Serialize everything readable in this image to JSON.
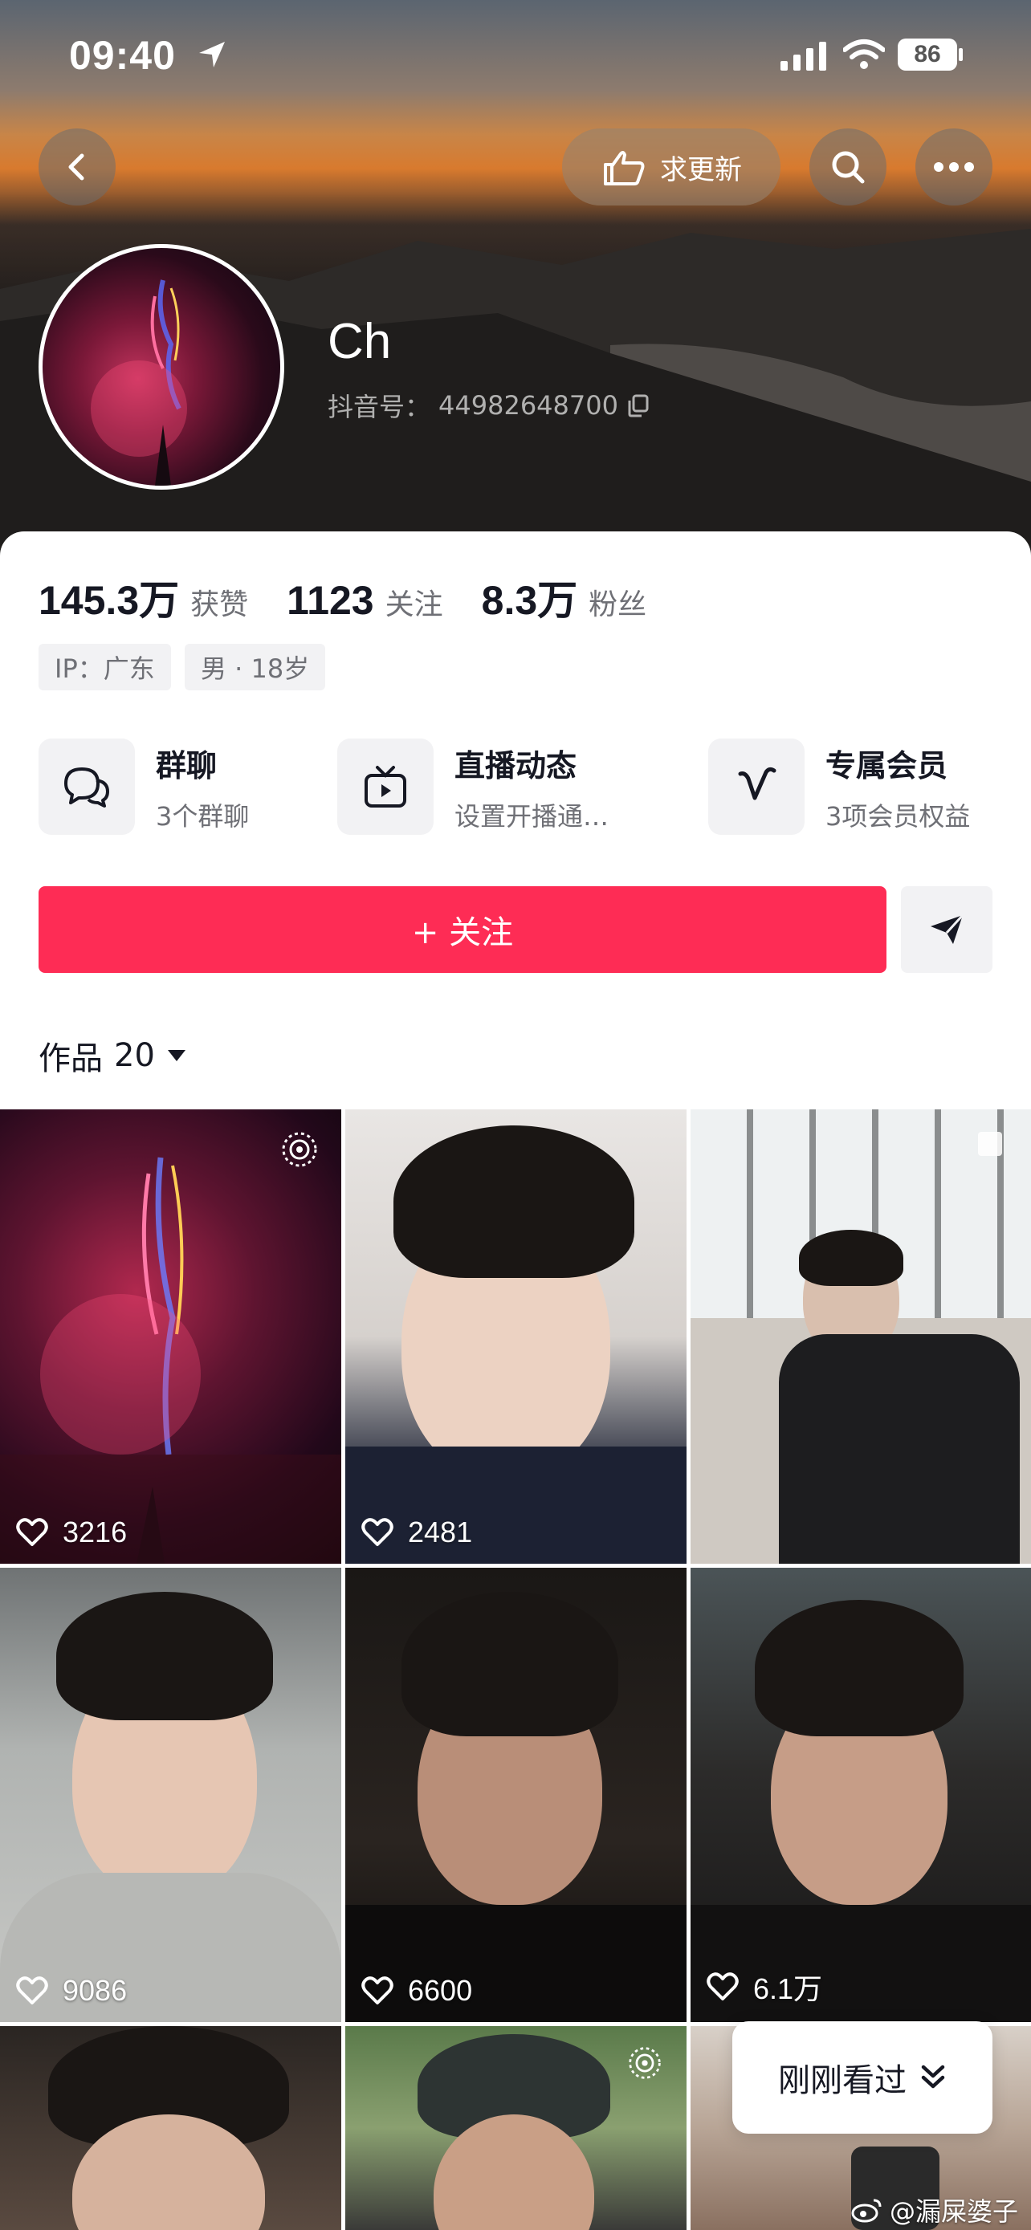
{
  "status_bar": {
    "time": "09:40",
    "battery": "86"
  },
  "header": {
    "request_update_label": "求更新"
  },
  "profile": {
    "name": "Ch",
    "douyin_id_label": "抖音号：",
    "douyin_id": "44982648700"
  },
  "stats": [
    {
      "value": "145.3万",
      "label": "获赞"
    },
    {
      "value": "1123",
      "label": "关注"
    },
    {
      "value": "8.3万",
      "label": "粉丝"
    }
  ],
  "tags": [
    "IP：广东",
    "男 · 18岁"
  ],
  "features": [
    {
      "title": "群聊",
      "subtitle": "3个群聊",
      "icon": "chat-bubbles-icon"
    },
    {
      "title": "直播动态",
      "subtitle": "设置开播通…",
      "icon": "tv-icon"
    },
    {
      "title": "专属会员",
      "subtitle": "3项会员权益",
      "icon": "v-badge-icon"
    }
  ],
  "follow_label": "+ 关注",
  "works": {
    "label": "作品",
    "count": "20"
  },
  "videos": [
    {
      "likes": "3216"
    },
    {
      "likes": "2481"
    },
    {
      "likes": ""
    },
    {
      "likes": "9086"
    },
    {
      "likes": "6600"
    },
    {
      "likes": "6.1万"
    }
  ],
  "recently_viewed_label": "刚刚看过",
  "watermark": "@漏屎婆子",
  "colors": {
    "accent": "#fe2c55",
    "text": "#161823",
    "muted": "#6f7076",
    "chip_bg": "#f2f2f4"
  }
}
